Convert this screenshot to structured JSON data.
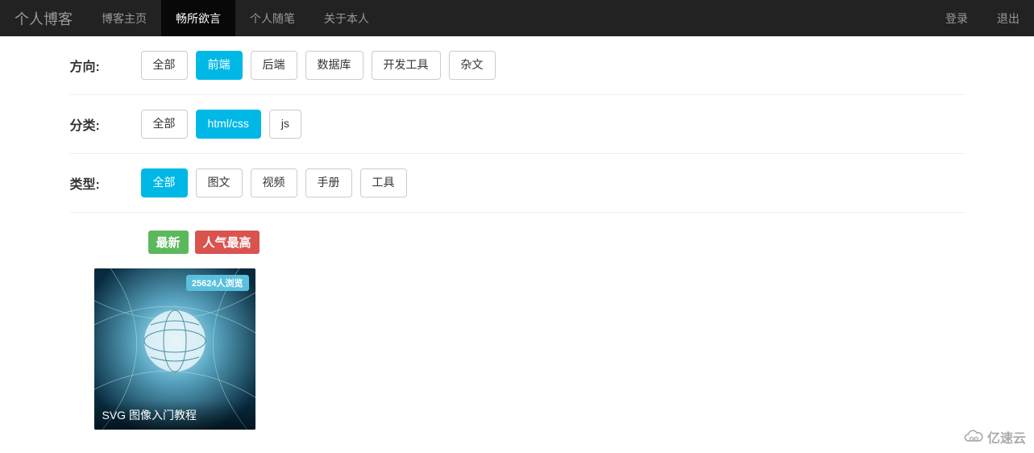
{
  "nav": {
    "brand": "个人博客",
    "items": [
      {
        "label": "博客主页",
        "active": false
      },
      {
        "label": "畅所欲言",
        "active": true
      },
      {
        "label": "个人随笔",
        "active": false
      },
      {
        "label": "关于本人",
        "active": false
      }
    ],
    "right": [
      {
        "label": "登录"
      },
      {
        "label": "退出"
      }
    ]
  },
  "filters": {
    "direction": {
      "label": "方向:",
      "options": [
        {
          "label": "全部",
          "active": false
        },
        {
          "label": "前端",
          "active": true
        },
        {
          "label": "后端",
          "active": false
        },
        {
          "label": "数据库",
          "active": false
        },
        {
          "label": "开发工具",
          "active": false
        },
        {
          "label": "杂文",
          "active": false
        }
      ]
    },
    "category": {
      "label": "分类:",
      "options": [
        {
          "label": "全部",
          "active": false
        },
        {
          "label": "html/css",
          "active": true
        },
        {
          "label": "js",
          "active": false
        }
      ]
    },
    "type": {
      "label": "类型:",
      "options": [
        {
          "label": "全部",
          "active": true
        },
        {
          "label": "图文",
          "active": false
        },
        {
          "label": "视频",
          "active": false
        },
        {
          "label": "手册",
          "active": false
        },
        {
          "label": "工具",
          "active": false
        }
      ]
    }
  },
  "sort": {
    "latest": "最新",
    "popular": "人气最高"
  },
  "cards": [
    {
      "views": "25624人浏览",
      "title": "SVG 图像入门教程"
    }
  ],
  "footer": {
    "brand": "亿速云"
  }
}
